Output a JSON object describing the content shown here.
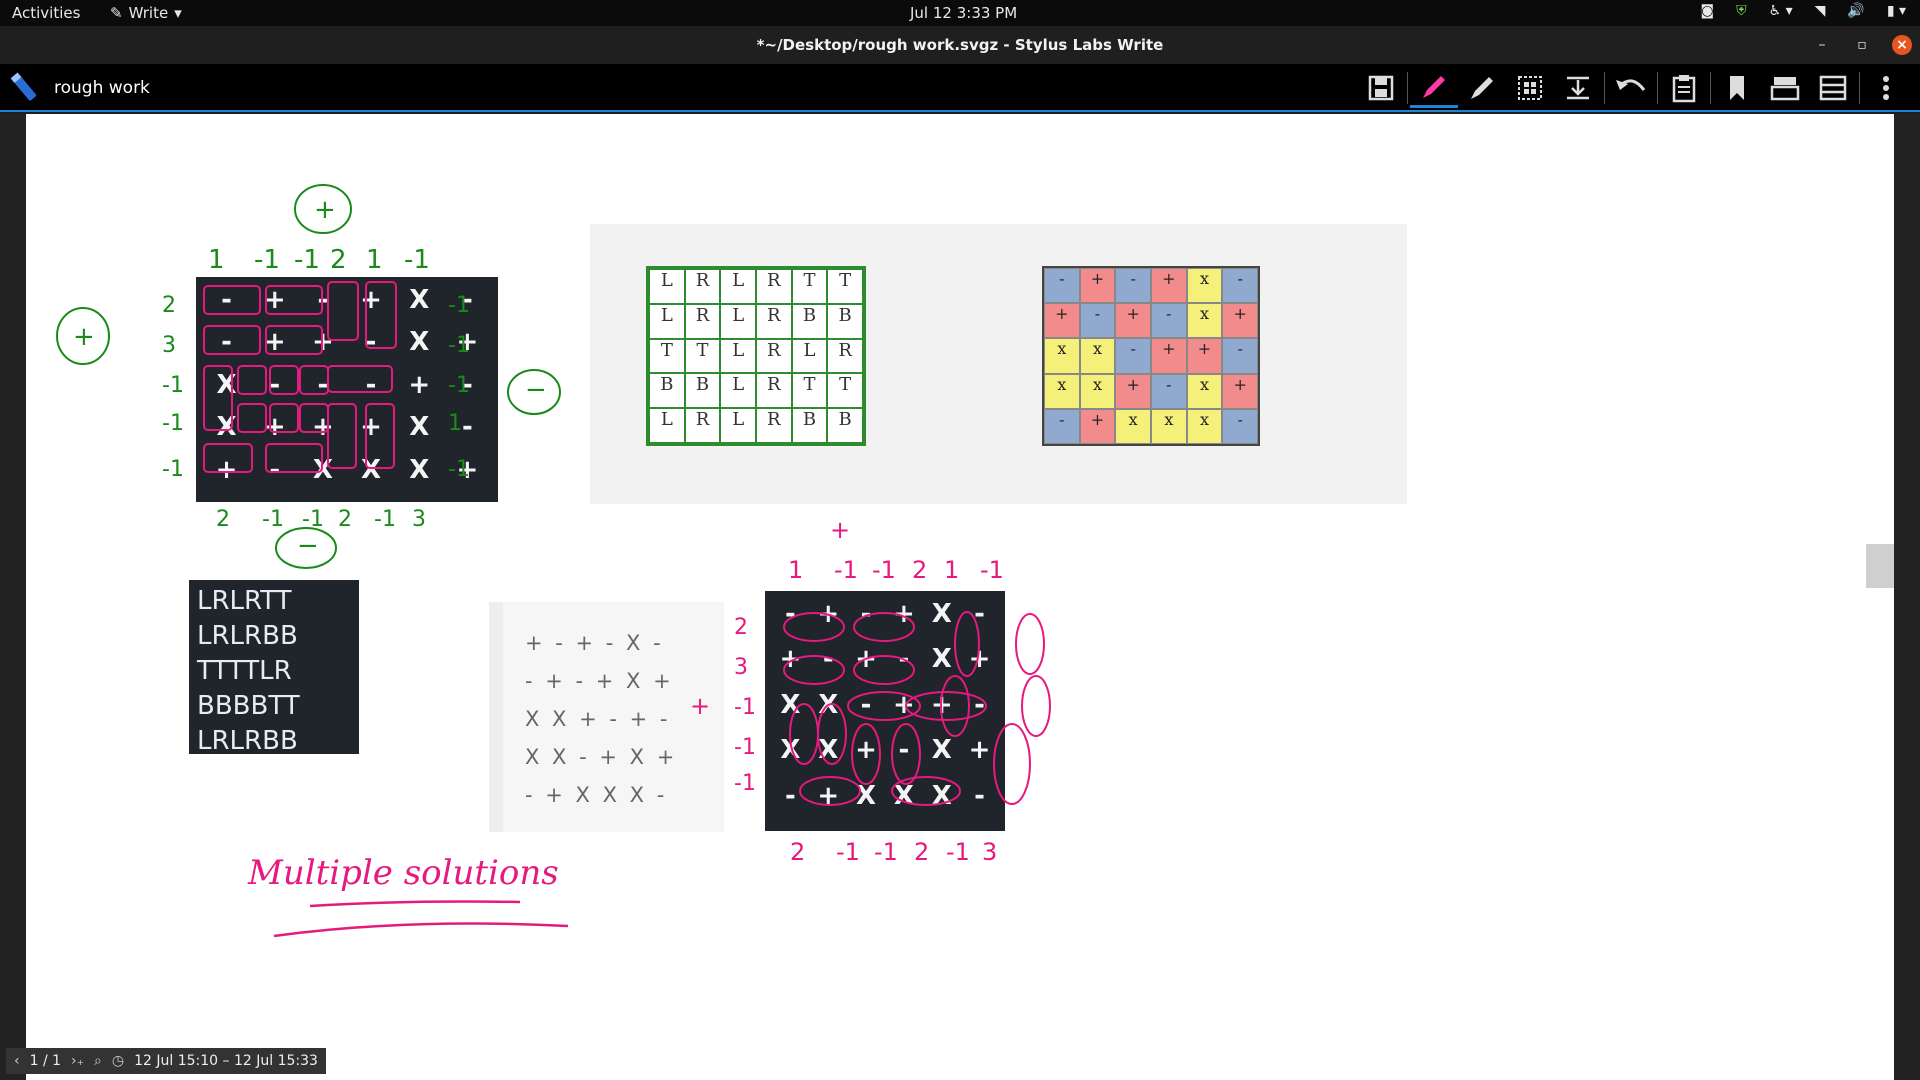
{
  "topbar": {
    "activities": "Activities",
    "app_name": "Write",
    "clock": "Jul 12  3:33 PM"
  },
  "window": {
    "title": "*~/Desktop/rough work.svgz - Stylus Labs Write"
  },
  "toolbar": {
    "document_name": "rough work"
  },
  "status": {
    "page": "1 / 1",
    "time_range": "12 Jul 15:10 – 12 Jul 15:33"
  },
  "panels": {
    "lr_lines": [
      "LRLRTT",
      "LRLRBB",
      "TTTTLR",
      "BBBBTT",
      "LRLRBB"
    ],
    "sign_grid_lines": [
      "+ - + - X -",
      "- + - + X +",
      "X X + - + -",
      "X X - + X +",
      "- + X X X -"
    ],
    "left_puzzle": [
      [
        "-",
        "+",
        "-",
        "+",
        "X",
        "-"
      ],
      [
        "-",
        "+",
        "+",
        "-",
        "X",
        "+"
      ],
      [
        "X",
        "-",
        "-",
        "-",
        "+",
        "-"
      ],
      [
        "X",
        "+",
        "+",
        "+",
        "X",
        "-"
      ],
      [
        "+",
        "-",
        "X",
        "X",
        "X",
        "+"
      ]
    ],
    "right_puzzle": [
      [
        "-",
        "+",
        "-",
        "+",
        "X",
        "-"
      ],
      [
        "+",
        "-",
        "+",
        "-",
        "X",
        "+"
      ],
      [
        "X",
        "X",
        "-",
        "+",
        "+",
        "-"
      ],
      [
        "X",
        "X",
        "+",
        "-",
        "X",
        "+"
      ],
      [
        "-",
        "+",
        "X",
        "X",
        "X",
        "-"
      ]
    ],
    "lr_grid": [
      [
        "L",
        "R",
        "L",
        "R",
        "T",
        "T"
      ],
      [
        "L",
        "R",
        "L",
        "R",
        "B",
        "B"
      ],
      [
        "T",
        "T",
        "L",
        "R",
        "L",
        "R"
      ],
      [
        "B",
        "B",
        "L",
        "R",
        "T",
        "T"
      ],
      [
        "L",
        "R",
        "L",
        "R",
        "B",
        "B"
      ]
    ]
  },
  "ink": {
    "plus_label": "+",
    "minus_label": "−",
    "top_counts": [
      "1",
      "-1",
      "-1",
      "2",
      "1",
      "-1"
    ],
    "bottom_counts": [
      "2",
      "-1",
      "-1",
      "2",
      "-1",
      "3"
    ],
    "left_counts": [
      "2",
      "3",
      "-1",
      "-1",
      "-1"
    ],
    "right_counts": [
      "-1",
      "-1",
      "-1",
      "1",
      "-1"
    ],
    "note": "Multiple solutions"
  }
}
